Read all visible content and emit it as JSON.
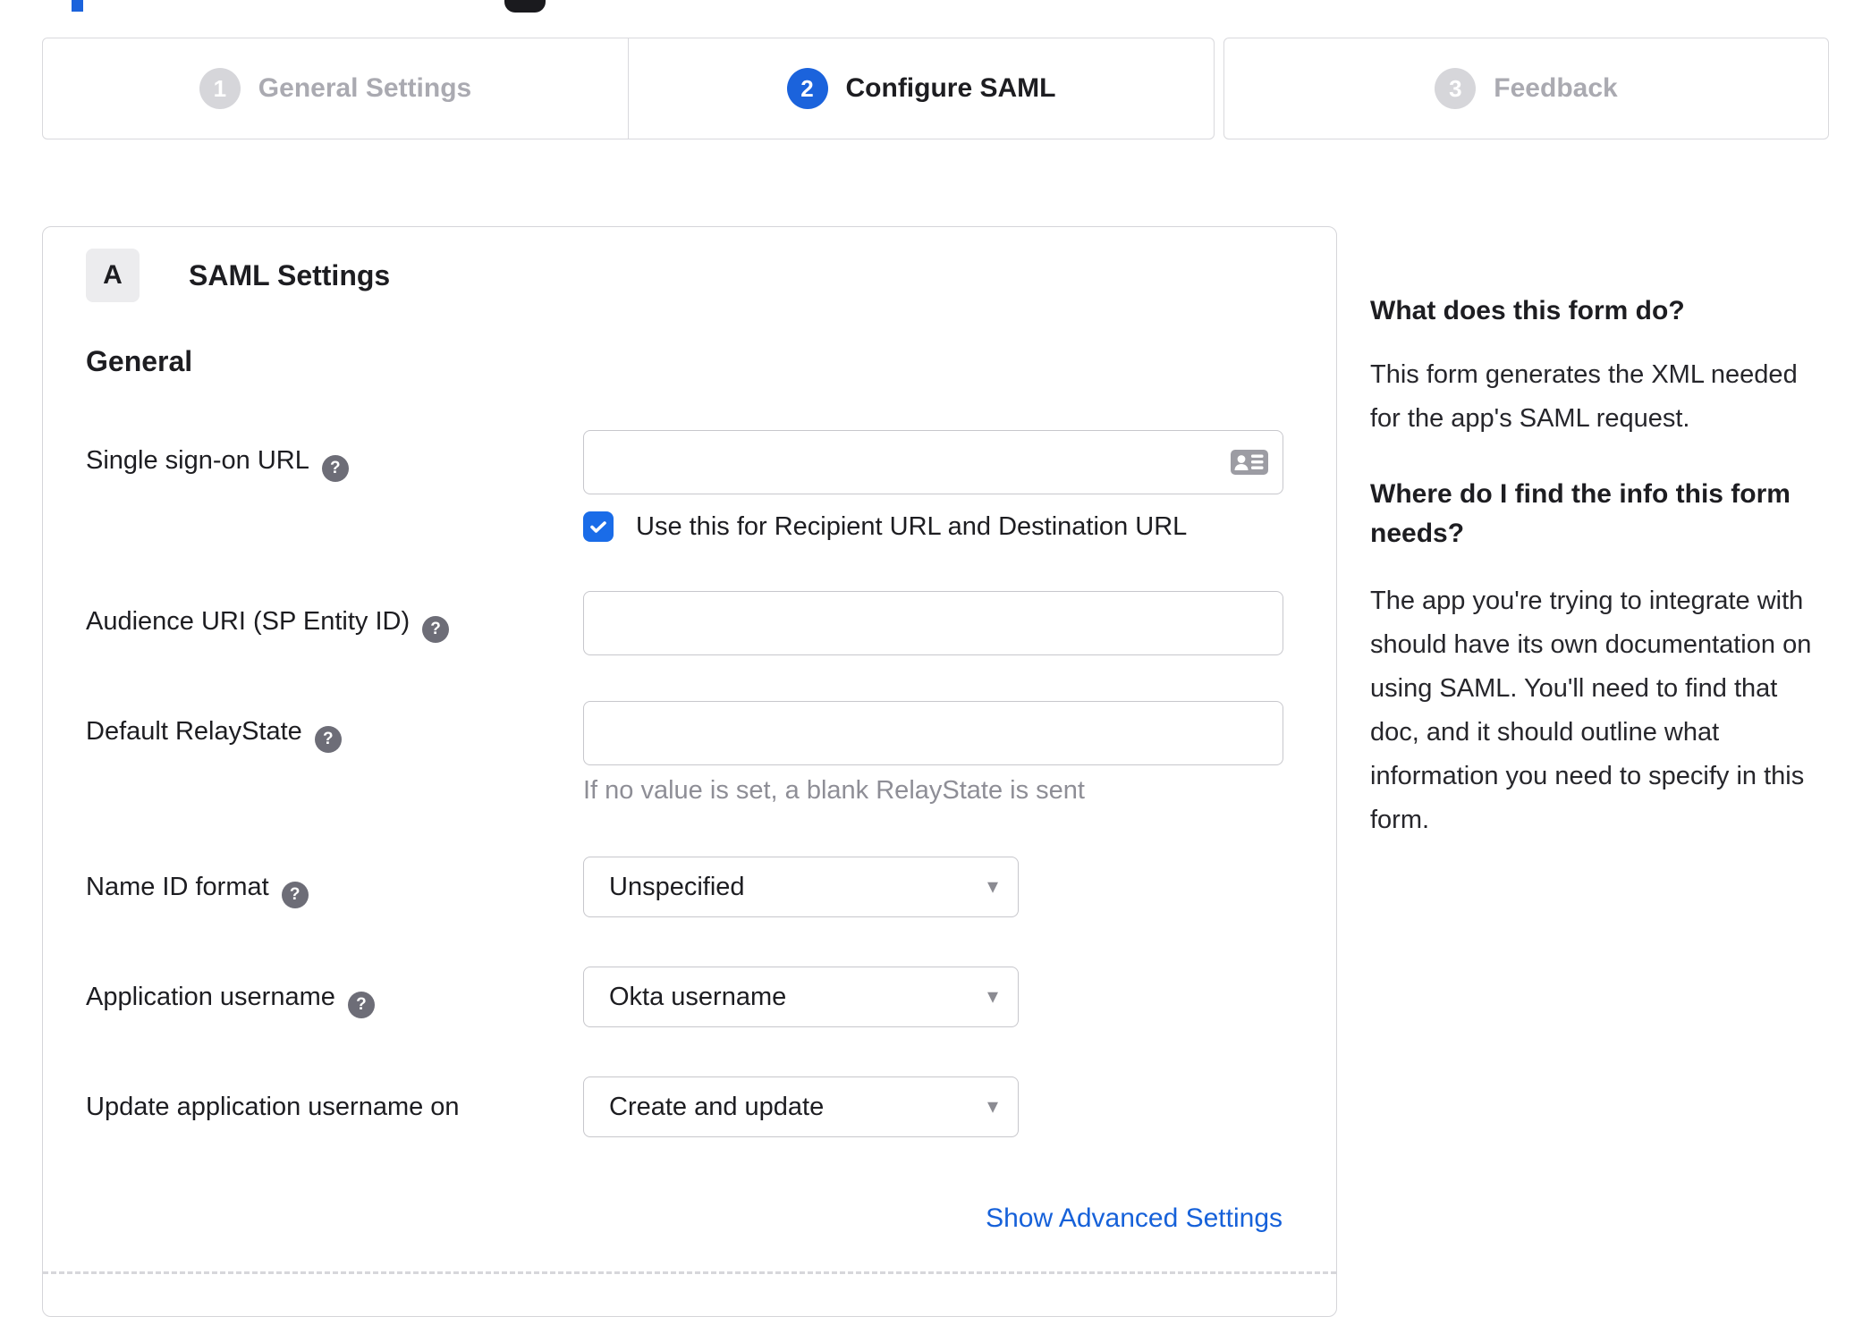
{
  "icons": {
    "help": "?",
    "chevron": "▾"
  },
  "colors": {
    "accent_blue": "#1b63dc",
    "checkbox_blue": "#1a6ce8",
    "link_blue": "#1661d9",
    "inactive_gray": "#d6d6da"
  },
  "stepper": {
    "steps": [
      {
        "number": "1",
        "label": "General Settings",
        "state": "inactive"
      },
      {
        "number": "2",
        "label": "Configure SAML",
        "state": "active"
      },
      {
        "number": "3",
        "label": "Feedback",
        "state": "inactive"
      }
    ]
  },
  "panel": {
    "badge": "A",
    "title": "SAML Settings",
    "section": "General",
    "fields": [
      {
        "label": "Single sign-on URL",
        "type": "text",
        "value": "",
        "checkbox_checked": true,
        "checkbox_label": "Use this for Recipient URL and Destination URL"
      },
      {
        "label": "Audience URI (SP Entity ID)",
        "type": "text",
        "value": ""
      },
      {
        "label": "Default RelayState",
        "type": "text",
        "value": "",
        "helper": "If no value is set, a blank RelayState is sent"
      },
      {
        "label": "Name ID format",
        "type": "select",
        "value": "Unspecified"
      },
      {
        "label": "Application username",
        "type": "select",
        "value": "Okta username"
      },
      {
        "label": "Update application username on",
        "type": "select",
        "value": "Create and update"
      }
    ],
    "advanced_link": "Show Advanced Settings"
  },
  "sidebar": {
    "block1": {
      "title": "What does this form do?",
      "lines": [
        "This form generates the XML needed",
        "for the app's SAML request."
      ]
    },
    "block2": {
      "title_lines": [
        "Where do I find the info this form",
        "needs?"
      ],
      "lines": [
        "The app you're trying to integrate with",
        "should have its own documentation on",
        "using SAML. You'll need to find that",
        "doc, and it should outline what",
        "information you need to specify in this",
        "form."
      ]
    }
  }
}
